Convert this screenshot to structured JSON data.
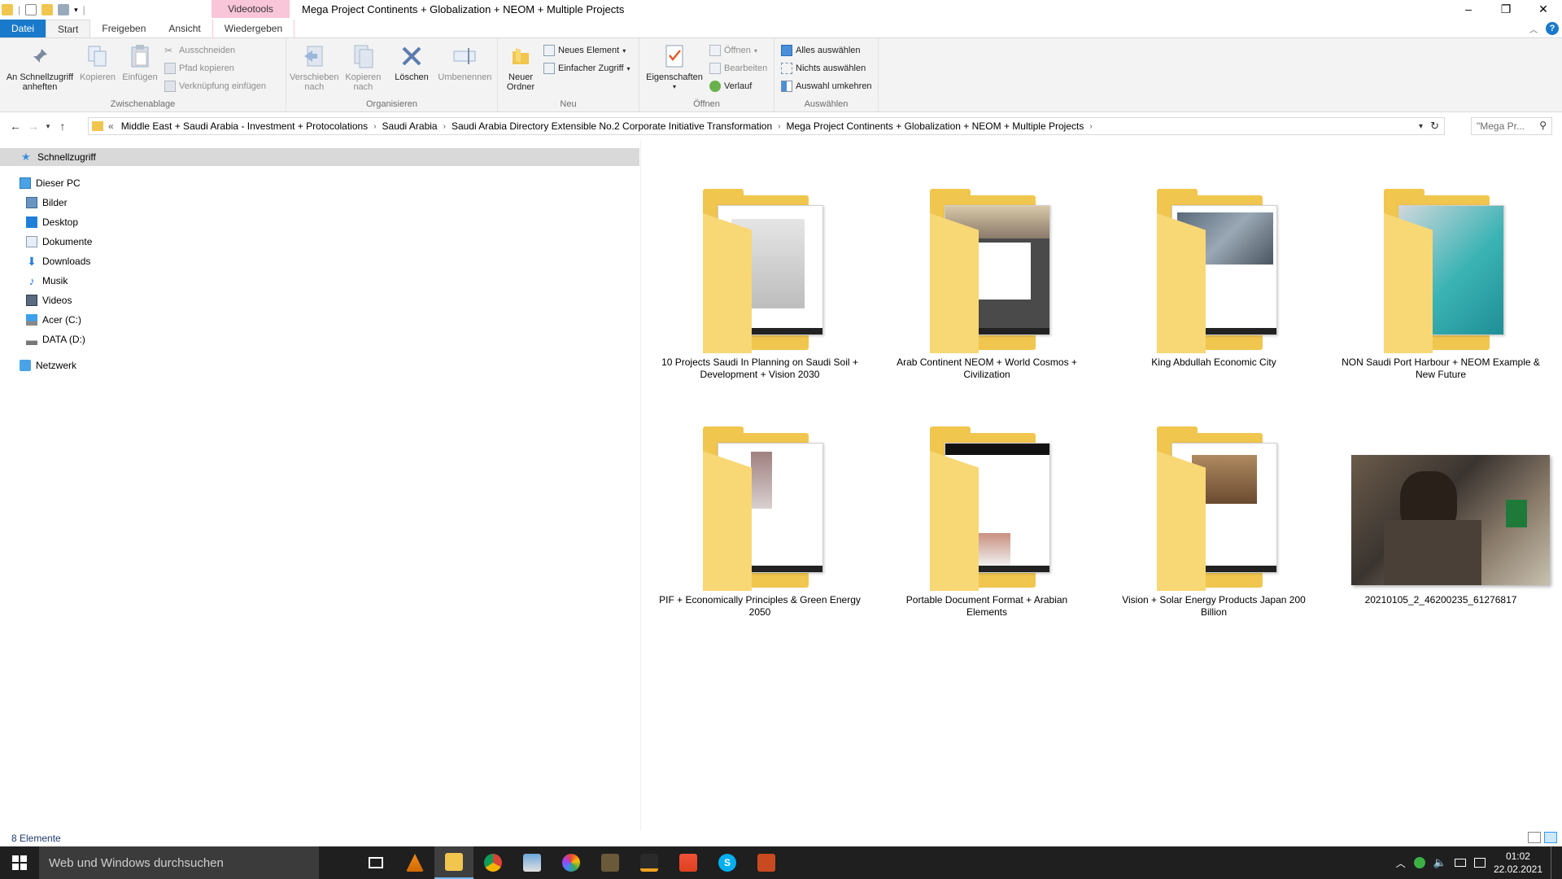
{
  "window": {
    "title": "Mega Project Continents + Globalization + NEOM + Multiple Projects",
    "context_tab_header": "Videotools"
  },
  "tabs": [
    {
      "label": "Datei"
    },
    {
      "label": "Start"
    },
    {
      "label": "Freigeben"
    },
    {
      "label": "Ansicht"
    },
    {
      "label": "Wiedergeben"
    }
  ],
  "ribbon": {
    "clipboard": {
      "label": "Zwischenablage",
      "pin": "An Schnellzugriff anheften",
      "copy": "Kopieren",
      "paste": "Einfügen",
      "cut": "Ausschneiden",
      "copy_path": "Pfad kopieren",
      "paste_shortcut": "Verknüpfung einfügen"
    },
    "organize": {
      "label": "Organisieren",
      "move_to": "Verschieben nach",
      "copy_to": "Kopieren nach",
      "delete": "Löschen",
      "rename": "Umbenennen"
    },
    "new": {
      "label": "Neu",
      "new_folder": "Neuer Ordner",
      "new_item": "Neues Element",
      "easy_access": "Einfacher Zugriff"
    },
    "open": {
      "label": "Öffnen",
      "properties": "Eigenschaften",
      "open": "Öffnen",
      "edit": "Bearbeiten",
      "history": "Verlauf"
    },
    "select": {
      "label": "Auswählen",
      "select_all": "Alles auswählen",
      "select_none": "Nichts auswählen",
      "invert": "Auswahl umkehren"
    }
  },
  "address": {
    "prefix": "«",
    "crumbs": [
      "Middle East + Saudi Arabia - Investment + Protocolations",
      "Saudi Arabia",
      "Saudi Arabia Directory Extensible No.2  Corporate Initiative Transformation",
      "Mega Project Continents + Globalization + NEOM + Multiple Projects"
    ],
    "search_placeholder": "\"Mega Pr..."
  },
  "nav": {
    "quick_access": "Schnellzugriff",
    "this_pc": "Dieser PC",
    "items": [
      "Bilder",
      "Desktop",
      "Dokumente",
      "Downloads",
      "Musik",
      "Videos",
      "Acer (C:)",
      "DATA (D:)"
    ],
    "network": "Netzwerk"
  },
  "files": [
    {
      "name": "10 Projects Saudi In Planning on Saudi Soil + Development + Vision 2030",
      "type": "folder"
    },
    {
      "name": "Arab Continent NEOM + World Cosmos + Civilization",
      "type": "folder"
    },
    {
      "name": "King Abdullah Economic City",
      "type": "folder"
    },
    {
      "name": "NON Saudi Port Harbour + NEOM Example & New Future",
      "type": "folder"
    },
    {
      "name": "PIF + Economically Principles & Green Energy 2050",
      "type": "folder"
    },
    {
      "name": "Portable Document Format + Arabian Elements",
      "type": "folder"
    },
    {
      "name": "Vision + Solar Energy Products Japan 200 Billion",
      "type": "folder"
    },
    {
      "name": "20210105_2_46200235_61276817",
      "type": "image"
    }
  ],
  "status": {
    "count": "8 Elemente"
  },
  "taskbar": {
    "search_placeholder": "Web und Windows durchsuchen",
    "time": "01:02",
    "date": "22.02.2021"
  }
}
